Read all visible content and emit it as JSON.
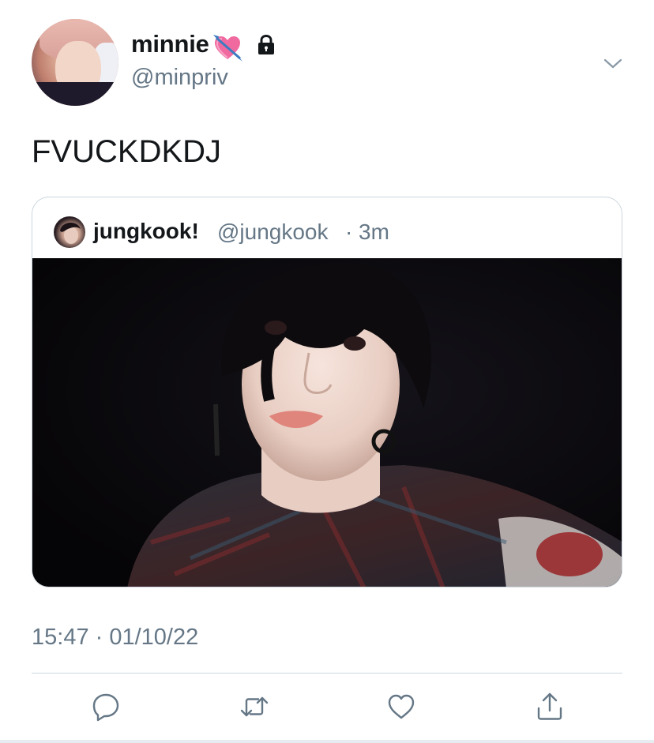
{
  "author": {
    "display_name": "minnie",
    "name_emoji": "heart-with-arrow-emoji",
    "protected_icon": "lock-icon",
    "username": "@minpriv"
  },
  "menu_icon": "chevron-down-icon",
  "tweet": {
    "text": "FVUCKDKDJ",
    "timestamp": "15:47 · 01/10/22"
  },
  "quoted_tweet": {
    "display_name": "jungkook!",
    "username": "@jungkook",
    "separator": "·",
    "time": "3m",
    "media": "photo"
  },
  "actions": [
    {
      "name": "reply",
      "icon": "reply-icon"
    },
    {
      "name": "retweet",
      "icon": "retweet-icon"
    },
    {
      "name": "like",
      "icon": "heart-icon"
    },
    {
      "name": "share",
      "icon": "share-icon"
    }
  ],
  "colors": {
    "text_primary": "#14171a",
    "text_secondary": "#657786",
    "border": "#ccd6dd",
    "icon": "#657786"
  }
}
